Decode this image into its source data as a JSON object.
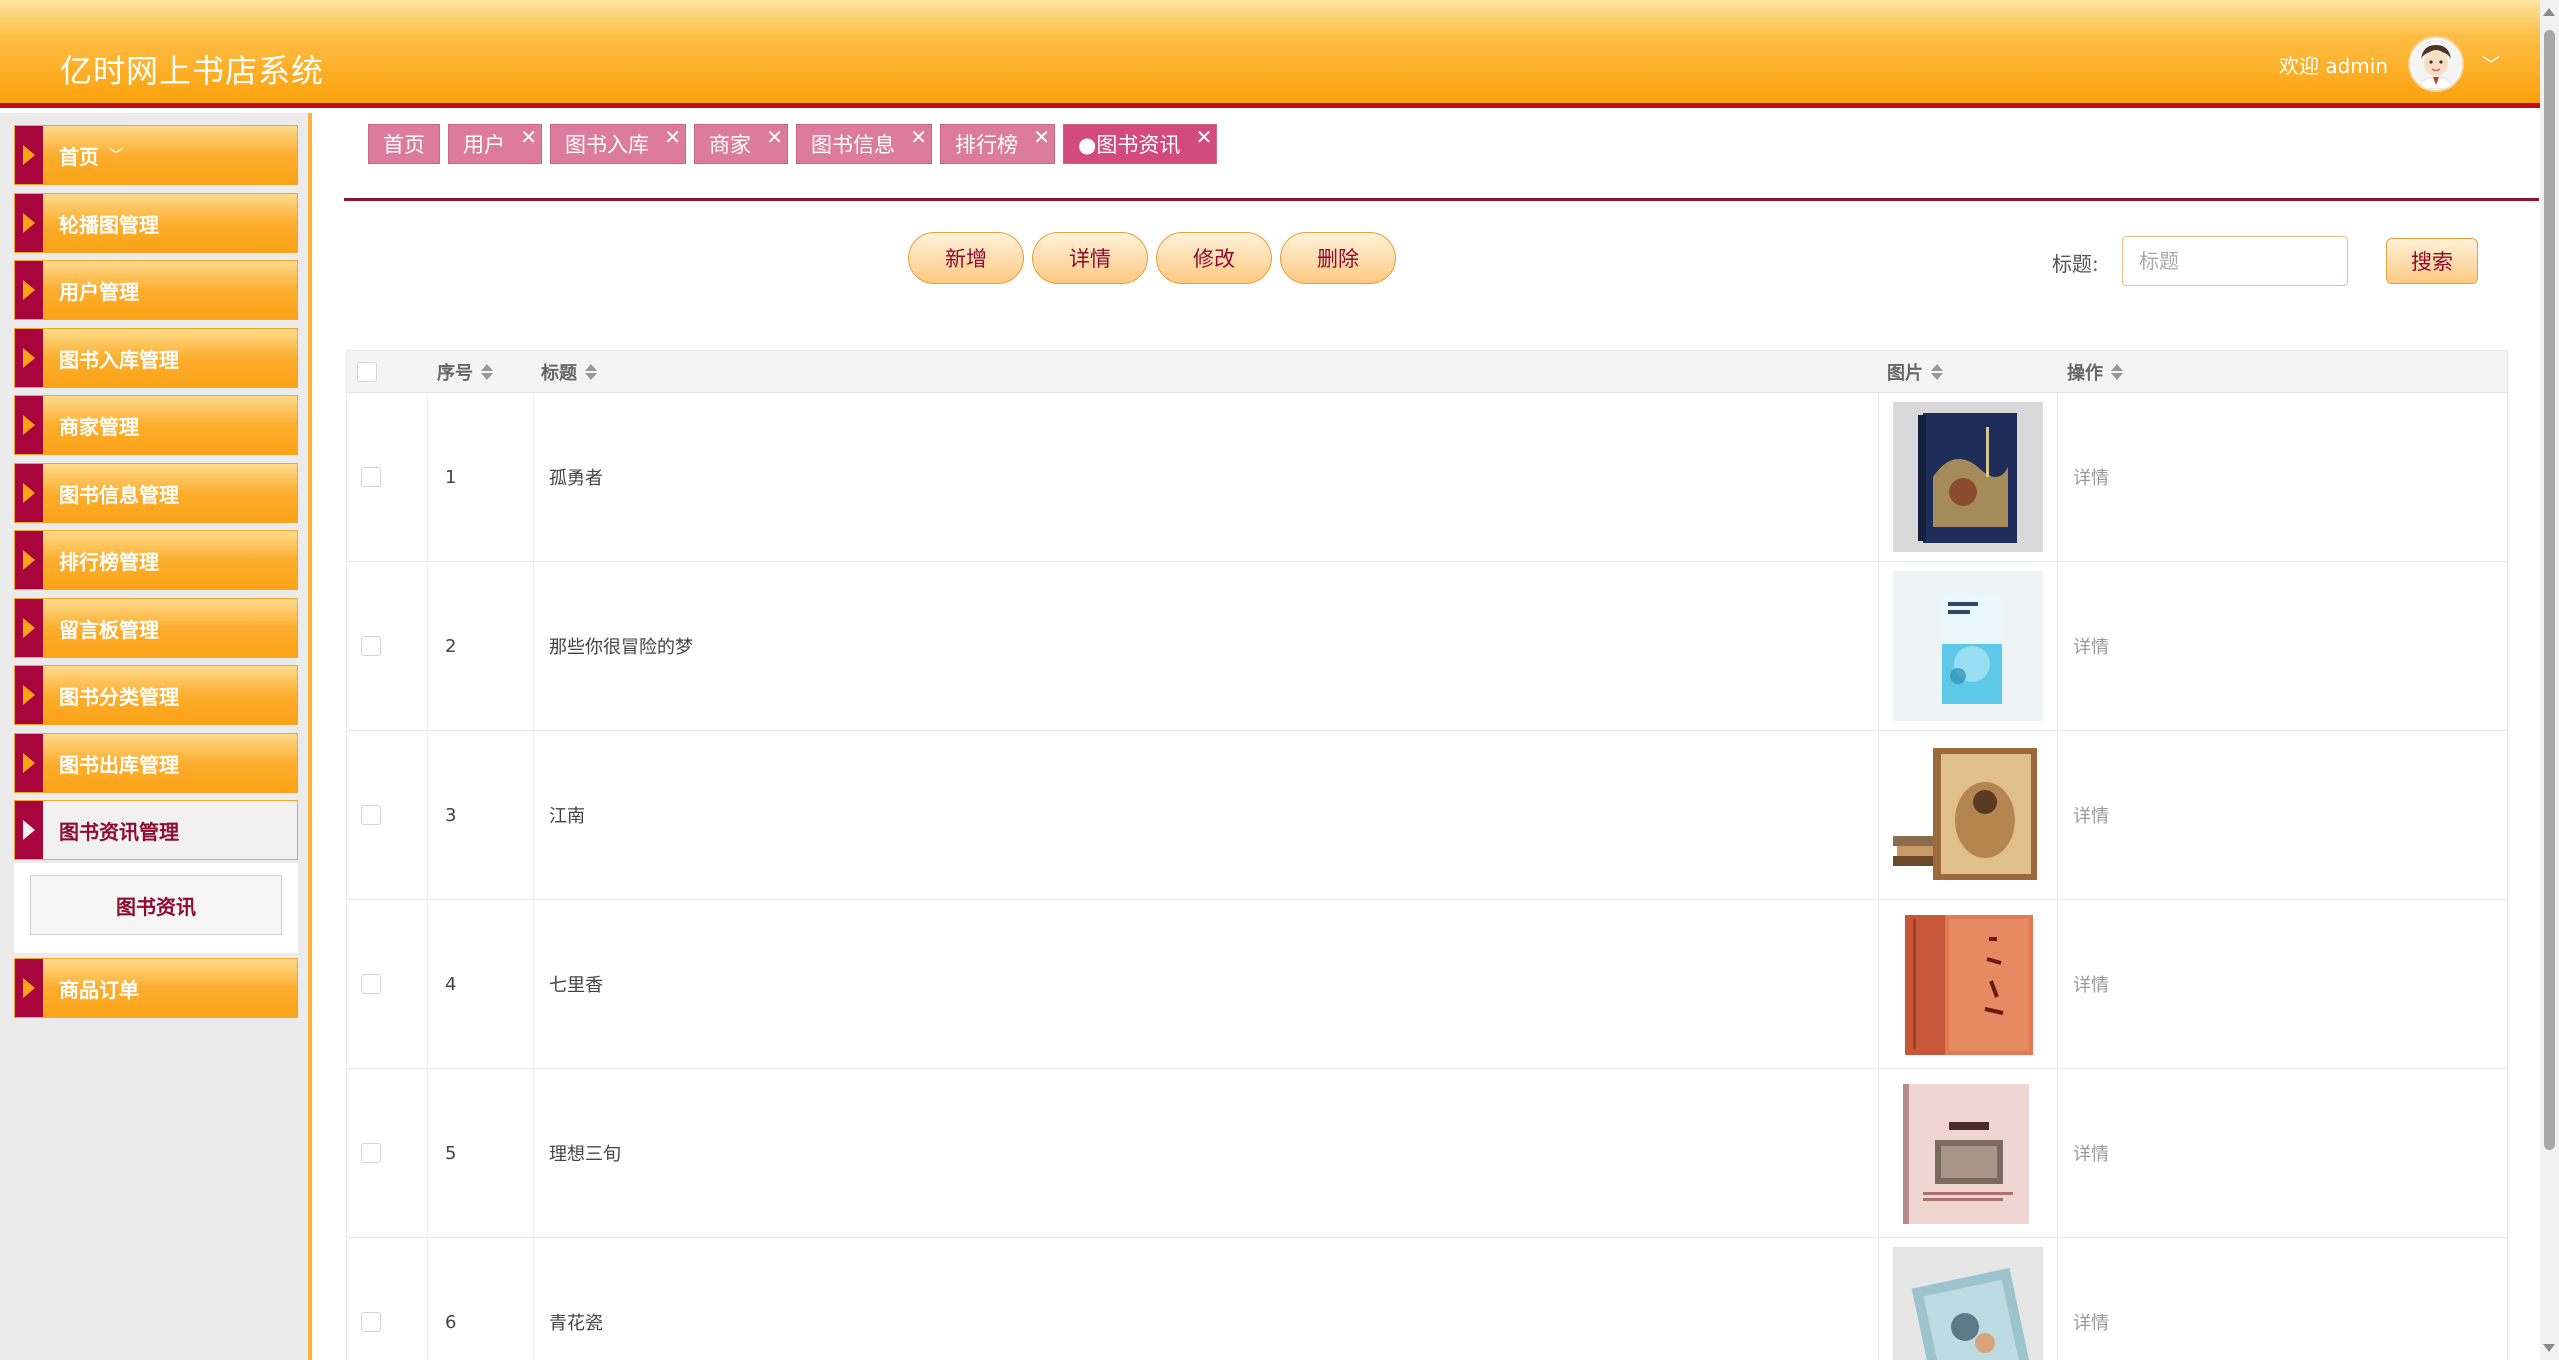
{
  "header": {
    "title": "亿时网上书店系统",
    "welcome": "欢迎 admin"
  },
  "sidebar": {
    "items": [
      {
        "label": "首页"
      },
      {
        "label": "轮播图管理"
      },
      {
        "label": "用户管理"
      },
      {
        "label": "图书入库管理"
      },
      {
        "label": "商家管理"
      },
      {
        "label": "图书信息管理"
      },
      {
        "label": "排行榜管理"
      },
      {
        "label": "留言板管理"
      },
      {
        "label": "图书分类管理"
      },
      {
        "label": "图书出库管理"
      },
      {
        "label": "图书资讯管理"
      },
      {
        "label": "商品订单"
      }
    ],
    "submenu_label": "图书资讯"
  },
  "tabs": [
    {
      "label": "首页"
    },
    {
      "label": "用户"
    },
    {
      "label": "图书入库"
    },
    {
      "label": "商家"
    },
    {
      "label": "图书信息"
    },
    {
      "label": "排行榜"
    },
    {
      "label": "●图书资讯"
    }
  ],
  "tab_close_glyph": "✕",
  "toolbar": {
    "add_label": "新增",
    "detail_label": "详情",
    "edit_label": "修改",
    "delete_label": "删除"
  },
  "search": {
    "label": "标题:",
    "placeholder": "标题",
    "button_label": "搜索"
  },
  "table": {
    "headers": {
      "index": "序号",
      "title": "标题",
      "image": "图片",
      "action": "操作"
    },
    "rows": [
      {
        "index": "1",
        "title": "孤勇者",
        "action": "详情"
      },
      {
        "index": "2",
        "title": "那些你很冒险的梦",
        "action": "详情"
      },
      {
        "index": "3",
        "title": "江南",
        "action": "详情"
      },
      {
        "index": "4",
        "title": "七里香",
        "action": "详情"
      },
      {
        "index": "5",
        "title": "理想三旬",
        "action": "详情"
      },
      {
        "index": "6",
        "title": "青花瓷",
        "action": "详情"
      }
    ]
  },
  "colors": {
    "header_orange": "#fca20c",
    "header_border": "#c40a12",
    "accent_crimson": "#8e0b32",
    "tab_pink": "#dd7b9c"
  }
}
